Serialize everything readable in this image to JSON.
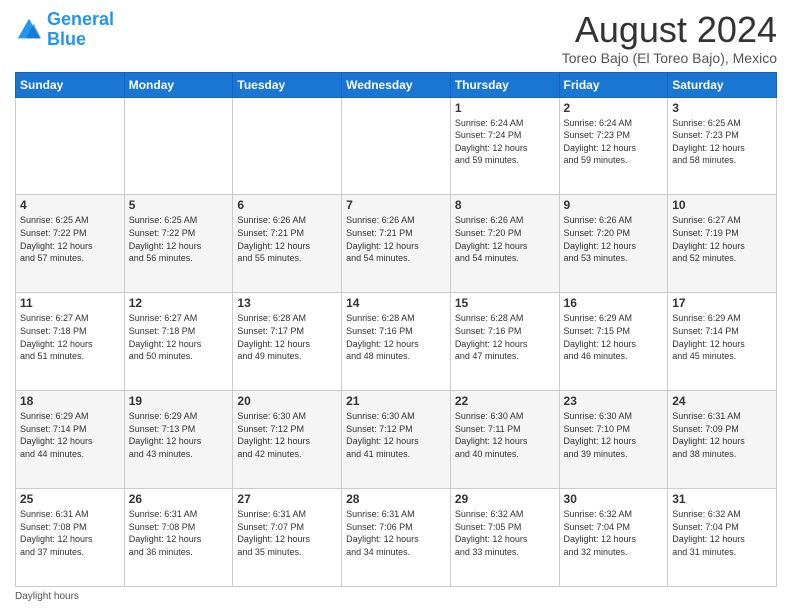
{
  "logo": {
    "line1": "General",
    "line2": "Blue"
  },
  "title": "August 2024",
  "subtitle": "Toreo Bajo (El Toreo Bajo), Mexico",
  "days_of_week": [
    "Sunday",
    "Monday",
    "Tuesday",
    "Wednesday",
    "Thursday",
    "Friday",
    "Saturday"
  ],
  "footer_note": "Daylight hours",
  "weeks": [
    [
      {
        "day": "",
        "info": ""
      },
      {
        "day": "",
        "info": ""
      },
      {
        "day": "",
        "info": ""
      },
      {
        "day": "",
        "info": ""
      },
      {
        "day": "1",
        "info": "Sunrise: 6:24 AM\nSunset: 7:24 PM\nDaylight: 12 hours\nand 59 minutes."
      },
      {
        "day": "2",
        "info": "Sunrise: 6:24 AM\nSunset: 7:23 PM\nDaylight: 12 hours\nand 59 minutes."
      },
      {
        "day": "3",
        "info": "Sunrise: 6:25 AM\nSunset: 7:23 PM\nDaylight: 12 hours\nand 58 minutes."
      }
    ],
    [
      {
        "day": "4",
        "info": "Sunrise: 6:25 AM\nSunset: 7:22 PM\nDaylight: 12 hours\nand 57 minutes."
      },
      {
        "day": "5",
        "info": "Sunrise: 6:25 AM\nSunset: 7:22 PM\nDaylight: 12 hours\nand 56 minutes."
      },
      {
        "day": "6",
        "info": "Sunrise: 6:26 AM\nSunset: 7:21 PM\nDaylight: 12 hours\nand 55 minutes."
      },
      {
        "day": "7",
        "info": "Sunrise: 6:26 AM\nSunset: 7:21 PM\nDaylight: 12 hours\nand 54 minutes."
      },
      {
        "day": "8",
        "info": "Sunrise: 6:26 AM\nSunset: 7:20 PM\nDaylight: 12 hours\nand 54 minutes."
      },
      {
        "day": "9",
        "info": "Sunrise: 6:26 AM\nSunset: 7:20 PM\nDaylight: 12 hours\nand 53 minutes."
      },
      {
        "day": "10",
        "info": "Sunrise: 6:27 AM\nSunset: 7:19 PM\nDaylight: 12 hours\nand 52 minutes."
      }
    ],
    [
      {
        "day": "11",
        "info": "Sunrise: 6:27 AM\nSunset: 7:18 PM\nDaylight: 12 hours\nand 51 minutes."
      },
      {
        "day": "12",
        "info": "Sunrise: 6:27 AM\nSunset: 7:18 PM\nDaylight: 12 hours\nand 50 minutes."
      },
      {
        "day": "13",
        "info": "Sunrise: 6:28 AM\nSunset: 7:17 PM\nDaylight: 12 hours\nand 49 minutes."
      },
      {
        "day": "14",
        "info": "Sunrise: 6:28 AM\nSunset: 7:16 PM\nDaylight: 12 hours\nand 48 minutes."
      },
      {
        "day": "15",
        "info": "Sunrise: 6:28 AM\nSunset: 7:16 PM\nDaylight: 12 hours\nand 47 minutes."
      },
      {
        "day": "16",
        "info": "Sunrise: 6:29 AM\nSunset: 7:15 PM\nDaylight: 12 hours\nand 46 minutes."
      },
      {
        "day": "17",
        "info": "Sunrise: 6:29 AM\nSunset: 7:14 PM\nDaylight: 12 hours\nand 45 minutes."
      }
    ],
    [
      {
        "day": "18",
        "info": "Sunrise: 6:29 AM\nSunset: 7:14 PM\nDaylight: 12 hours\nand 44 minutes."
      },
      {
        "day": "19",
        "info": "Sunrise: 6:29 AM\nSunset: 7:13 PM\nDaylight: 12 hours\nand 43 minutes."
      },
      {
        "day": "20",
        "info": "Sunrise: 6:30 AM\nSunset: 7:12 PM\nDaylight: 12 hours\nand 42 minutes."
      },
      {
        "day": "21",
        "info": "Sunrise: 6:30 AM\nSunset: 7:12 PM\nDaylight: 12 hours\nand 41 minutes."
      },
      {
        "day": "22",
        "info": "Sunrise: 6:30 AM\nSunset: 7:11 PM\nDaylight: 12 hours\nand 40 minutes."
      },
      {
        "day": "23",
        "info": "Sunrise: 6:30 AM\nSunset: 7:10 PM\nDaylight: 12 hours\nand 39 minutes."
      },
      {
        "day": "24",
        "info": "Sunrise: 6:31 AM\nSunset: 7:09 PM\nDaylight: 12 hours\nand 38 minutes."
      }
    ],
    [
      {
        "day": "25",
        "info": "Sunrise: 6:31 AM\nSunset: 7:08 PM\nDaylight: 12 hours\nand 37 minutes."
      },
      {
        "day": "26",
        "info": "Sunrise: 6:31 AM\nSunset: 7:08 PM\nDaylight: 12 hours\nand 36 minutes."
      },
      {
        "day": "27",
        "info": "Sunrise: 6:31 AM\nSunset: 7:07 PM\nDaylight: 12 hours\nand 35 minutes."
      },
      {
        "day": "28",
        "info": "Sunrise: 6:31 AM\nSunset: 7:06 PM\nDaylight: 12 hours\nand 34 minutes."
      },
      {
        "day": "29",
        "info": "Sunrise: 6:32 AM\nSunset: 7:05 PM\nDaylight: 12 hours\nand 33 minutes."
      },
      {
        "day": "30",
        "info": "Sunrise: 6:32 AM\nSunset: 7:04 PM\nDaylight: 12 hours\nand 32 minutes."
      },
      {
        "day": "31",
        "info": "Sunrise: 6:32 AM\nSunset: 7:04 PM\nDaylight: 12 hours\nand 31 minutes."
      }
    ]
  ]
}
